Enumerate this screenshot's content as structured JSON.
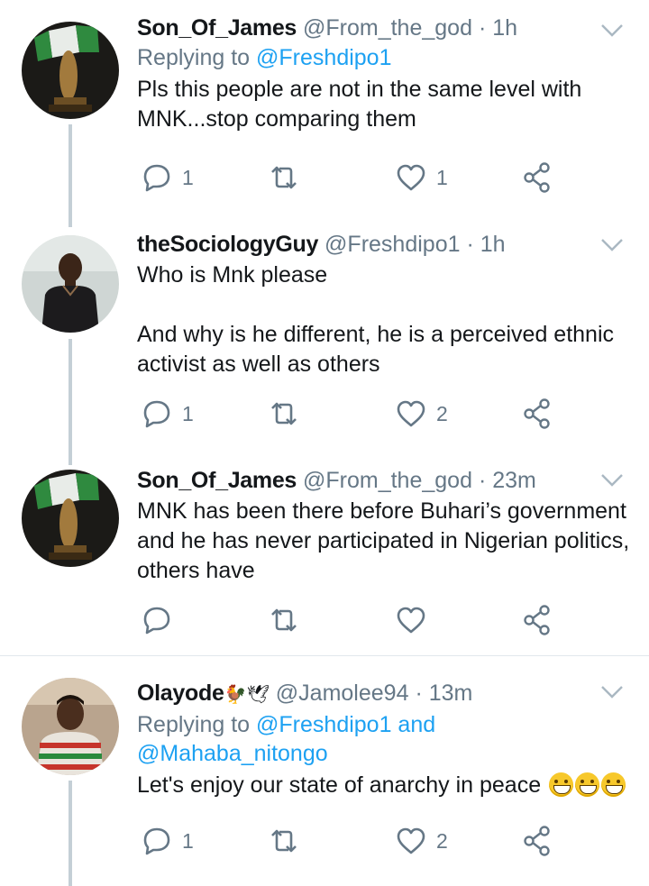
{
  "tweets": [
    {
      "name": "Son_Of_James",
      "handle": "@From_the_god",
      "time": "· 1h",
      "replying_label": "Replying to",
      "replying_to": "@Freshdipo1",
      "replying_to_2": "",
      "text": "Pls this people are not in the same level with MNK...stop comparing them",
      "replies": "1",
      "retweets": "",
      "likes": "1",
      "avatar": "nigeria-flag-statue-avatar"
    },
    {
      "name": "theSociologyGuy",
      "handle": "@Freshdipo1",
      "time": "· 1h",
      "text": "Who is Mnk please\n\nAnd why is he different, he is a perceived ethnic activist as well as others",
      "replies": "1",
      "retweets": "",
      "likes": "2",
      "avatar": "man-in-black-polo-avatar"
    },
    {
      "name": "Son_Of_James",
      "handle": "@From_the_god",
      "time": "· 23m",
      "text": "MNK has been there before Buhari’s government and he has never participated in Nigerian politics, others have",
      "replies": "",
      "retweets": "",
      "likes": "",
      "avatar": "nigeria-flag-statue-avatar"
    },
    {
      "name": "Olayode",
      "name_emojis": "🐓🕊",
      "handle": "@Jamolee94",
      "time": "· 13m",
      "replying_label": "Replying to",
      "replying_to": "@Freshdipo1 and",
      "replying_to_2": "@Mahaba_nitongo",
      "text": "Let's enjoy our state of anarchy in peace",
      "replies": "1",
      "retweets": "",
      "likes": "2",
      "avatar": "young-man-striped-shirt-avatar"
    }
  ],
  "colors": {
    "link": "#1da1f2",
    "meta": "#657786",
    "thread_line": "#c4cfd6",
    "divider": "#e1e8ed"
  }
}
